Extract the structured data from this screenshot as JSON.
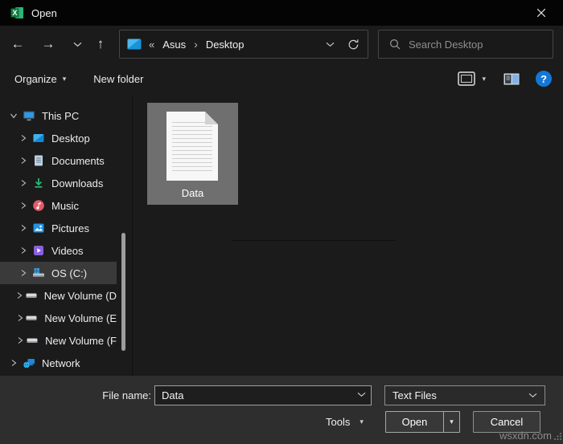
{
  "window": {
    "title": "Open"
  },
  "glyphs": {
    "back": "←",
    "forward": "→",
    "up": "↑",
    "overflow": "«",
    "crumb_separator": "›",
    "dropdown_triangle": "▾",
    "help": "?"
  },
  "nav": {
    "breadcrumb": {
      "items": [
        "Asus",
        "Desktop"
      ]
    },
    "search": {
      "placeholder": "Search Desktop"
    }
  },
  "toolbar": {
    "organize_label": "Organize",
    "new_folder_label": "New folder"
  },
  "sidebar": {
    "items": [
      {
        "label": "This PC",
        "icon": "this-pc-icon",
        "expanded": true
      },
      {
        "label": "Desktop",
        "icon": "desktop-icon"
      },
      {
        "label": "Documents",
        "icon": "documents-icon"
      },
      {
        "label": "Downloads",
        "icon": "downloads-icon"
      },
      {
        "label": "Music",
        "icon": "music-icon"
      },
      {
        "label": "Pictures",
        "icon": "pictures-icon"
      },
      {
        "label": "Videos",
        "icon": "videos-icon"
      },
      {
        "label": "OS (C:)",
        "icon": "os-drive-icon",
        "selected": true
      },
      {
        "label": "New Volume (D",
        "icon": "drive-icon"
      },
      {
        "label": "New Volume (E",
        "icon": "drive-icon"
      },
      {
        "label": "New Volume (F",
        "icon": "drive-icon"
      },
      {
        "label": "Network",
        "icon": "network-icon"
      }
    ]
  },
  "main": {
    "files": [
      {
        "name": "Data",
        "selected": true
      }
    ]
  },
  "footer": {
    "file_name_label": "File name:",
    "file_name_value": "Data",
    "file_type_value": "Text Files",
    "tools_label": "Tools",
    "open_label": "Open",
    "cancel_label": "Cancel"
  },
  "watermark": "wsxdn.com",
  "colors": {
    "titlebar": "#040404",
    "dialog_bg": "#1b1b1b",
    "footer_bg": "#2e2e2e",
    "tile_selection": "#6f6f6f",
    "sidebar_selection": "#3a3a3a",
    "help_blue": "#1377d6",
    "accent_blue": "#2193e6",
    "excel_green": "#107c41"
  }
}
